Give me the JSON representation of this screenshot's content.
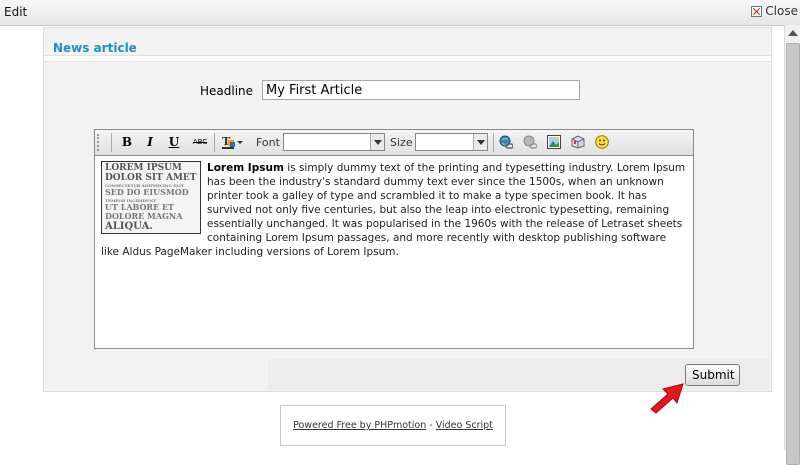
{
  "window": {
    "title": "Edit",
    "close_label": "Close"
  },
  "panel": {
    "title": "News article"
  },
  "form": {
    "headline_label": "Headline",
    "headline_value": "My First Article"
  },
  "editor": {
    "font_label": "Font",
    "font_value": "",
    "size_label": "Size",
    "size_value": "",
    "toolbar_buttons": [
      "bold",
      "italic",
      "underline",
      "strikethrough",
      "text-color",
      "link",
      "unlink",
      "image",
      "media",
      "emoticon"
    ],
    "image_text": [
      "LOREM IPSUM",
      "DOLOR SIT AMET",
      "CONSECTETUR ADIPISICING ELIT",
      "SED DO EIUSMOD",
      "TEMPOR INCIDIDUNT",
      "UT LABORE ET",
      "DOLORE MAGNA",
      "ALIQUA."
    ],
    "content_bold": "Lorem Ipsum",
    "content_text": " is simply dummy text of the printing and typesetting industry. Lorem Ipsum has been the industry's standard dummy text ever since the 1500s, when an unknown printer took a galley of type and scrambled it to make a type specimen book. It has survived not only five centuries, but also the leap into electronic typesetting, remaining essentially unchanged. It was popularised in the 1960s with the release of Letraset sheets containing Lorem Ipsum passages, and more recently with desktop publishing software like Aldus PageMaker including versions of Lorem Ipsum."
  },
  "actions": {
    "submit_label": "Submit"
  },
  "footer": {
    "powered_text": "Powered Free by PHPmotion",
    "separator": " - ",
    "script_link": "Video Script"
  },
  "colors": {
    "accent": "#1f8dc7",
    "annotation_arrow": "#e8151b"
  }
}
